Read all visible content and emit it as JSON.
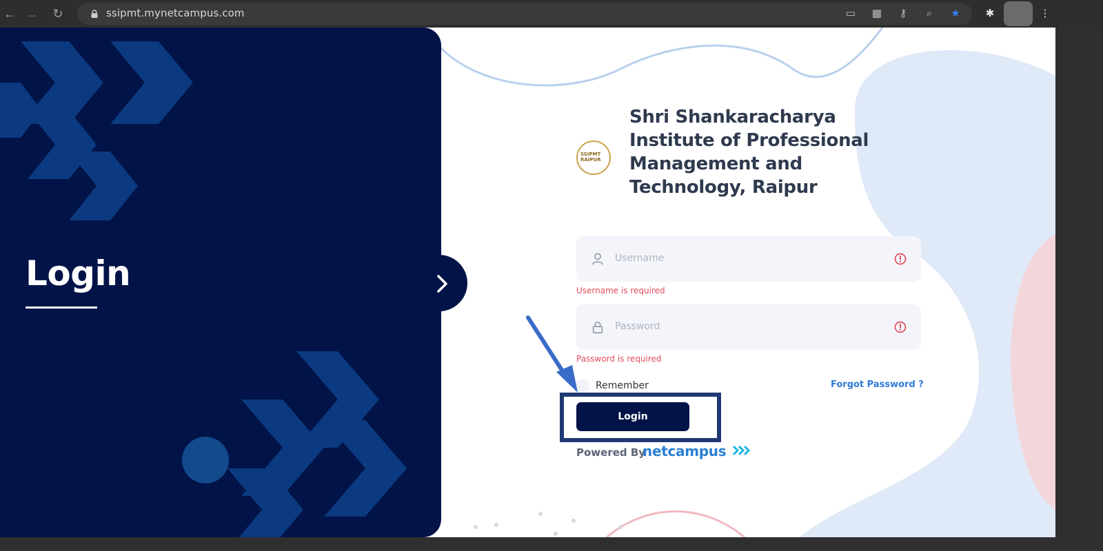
{
  "browser": {
    "url": "ssipmt.mynetcampus.com",
    "icons": [
      "back-icon",
      "forward-icon",
      "reload-icon",
      "lock-icon",
      "cast-icon",
      "qr-icon",
      "key-icon",
      "zoom-icon",
      "star-icon",
      "extensions-icon",
      "avatar",
      "menu-icon"
    ]
  },
  "left_panel": {
    "title": "Login"
  },
  "brand": {
    "name": "Shri Shankaracharya Institute of Professional Management and Technology, Raipur",
    "logo_text": "SSIPMT RAIPUR"
  },
  "form": {
    "username": {
      "placeholder": "Username",
      "error": "Username is required"
    },
    "password": {
      "placeholder": "Password",
      "error": "Password is required"
    },
    "remember_label": "Remember",
    "forgot_label": "Forgot Password ?",
    "submit_label": "Login",
    "powered_by_label": "Powered By",
    "powered_by_brand": "netcampus"
  },
  "colors": {
    "panel": "#011347",
    "accent": "#2e7ad6",
    "error": "#e04a5b",
    "annotation": "#3a6cc9"
  }
}
